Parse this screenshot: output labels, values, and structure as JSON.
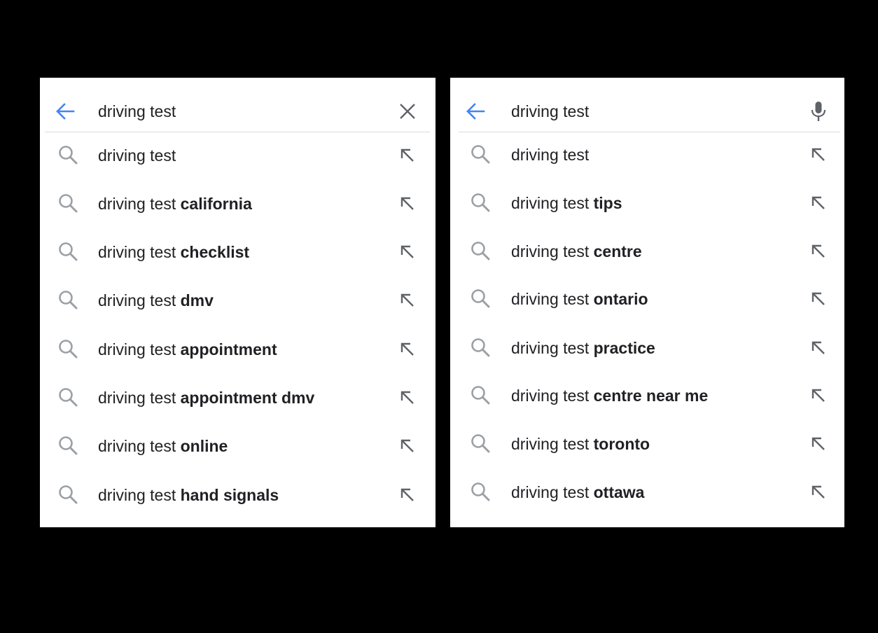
{
  "panels": [
    {
      "query": "driving test",
      "right_icon": "close-icon",
      "suggestions": [
        {
          "prefix": "driving test",
          "suffix": ""
        },
        {
          "prefix": "driving test ",
          "suffix": "california"
        },
        {
          "prefix": "driving test ",
          "suffix": "checklist"
        },
        {
          "prefix": "driving test ",
          "suffix": "dmv"
        },
        {
          "prefix": "driving test ",
          "suffix": "appointment"
        },
        {
          "prefix": "driving test ",
          "suffix": "appointment dmv"
        },
        {
          "prefix": "driving test ",
          "suffix": "online"
        },
        {
          "prefix": "driving test ",
          "suffix": "hand signals"
        }
      ]
    },
    {
      "query": "driving test",
      "right_icon": "microphone-icon",
      "suggestions": [
        {
          "prefix": "driving test",
          "suffix": ""
        },
        {
          "prefix": "driving test ",
          "suffix": "tips"
        },
        {
          "prefix": "driving test ",
          "suffix": "centre"
        },
        {
          "prefix": "driving test ",
          "suffix": "ontario"
        },
        {
          "prefix": "driving test ",
          "suffix": "practice"
        },
        {
          "prefix": "driving test ",
          "suffix": "centre near me"
        },
        {
          "prefix": "driving test ",
          "suffix": "toronto"
        },
        {
          "prefix": "driving test ",
          "suffix": "ottawa"
        }
      ]
    }
  ],
  "icons": {
    "back": "arrow-left-icon",
    "suggestion": "search-icon",
    "fill": "arrow-up-left-icon"
  },
  "colors": {
    "back_arrow": "#4285f4",
    "icon_gray": "#5f6368",
    "search_gray": "#9aa0a6",
    "text": "#202124",
    "divider": "#dadce0"
  }
}
